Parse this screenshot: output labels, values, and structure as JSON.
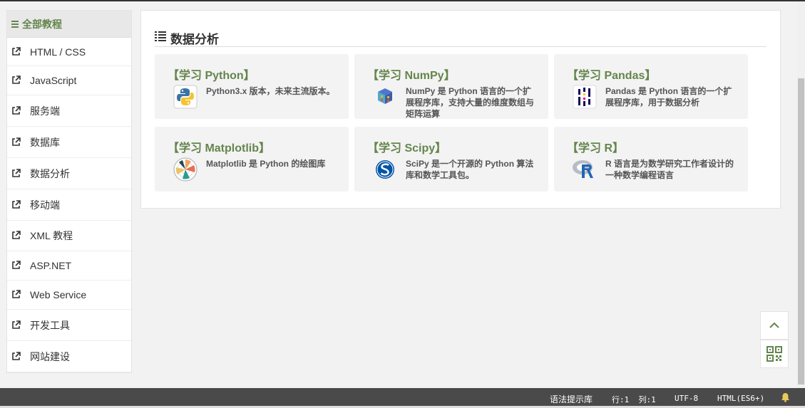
{
  "sidebar": {
    "header": "全部教程",
    "items": [
      {
        "label": "HTML / CSS"
      },
      {
        "label": "JavaScript"
      },
      {
        "label": "服务端"
      },
      {
        "label": "数据库"
      },
      {
        "label": "数据分析"
      },
      {
        "label": "移动端"
      },
      {
        "label": "XML 教程"
      },
      {
        "label": "ASP.NET"
      },
      {
        "label": "Web Service"
      },
      {
        "label": "开发工具"
      },
      {
        "label": "网站建设"
      }
    ]
  },
  "main": {
    "section_title": "数据分析",
    "cards": [
      {
        "title": "【学习 Python】",
        "desc": "Python3.x 版本，未来主流版本。",
        "icon": "python-logo"
      },
      {
        "title": "【学习 NumPy】",
        "desc": "NumPy 是 Python 语言的一个扩展程序库，支持大量的维度数组与矩阵运算",
        "icon": "numpy-logo"
      },
      {
        "title": "【学习 Pandas】",
        "desc": "Pandas 是 Python 语言的一个扩展程序库，用于数据分析",
        "icon": "pandas-logo"
      },
      {
        "title": "【学习 Matplotlib】",
        "desc": "Matplotlib 是 Python 的绘图库",
        "icon": "matplotlib-logo"
      },
      {
        "title": "【学习 Scipy】",
        "desc": "SciPy 是一个开源的 Python 算法库和数学工具包。",
        "icon": "scipy-logo"
      },
      {
        "title": "【学习 R】",
        "desc": "R 语言是为数学研究工作者设计的一种数学编程语言",
        "icon": "r-logo"
      }
    ]
  },
  "statusbar": {
    "syntax_hint": "语法提示库",
    "position": "行:1  列:1",
    "encoding": "UTF-8",
    "language": "HTML(ES6+)"
  },
  "colors": {
    "accent": "#64854c",
    "statusbar": "#4a4a4a"
  }
}
